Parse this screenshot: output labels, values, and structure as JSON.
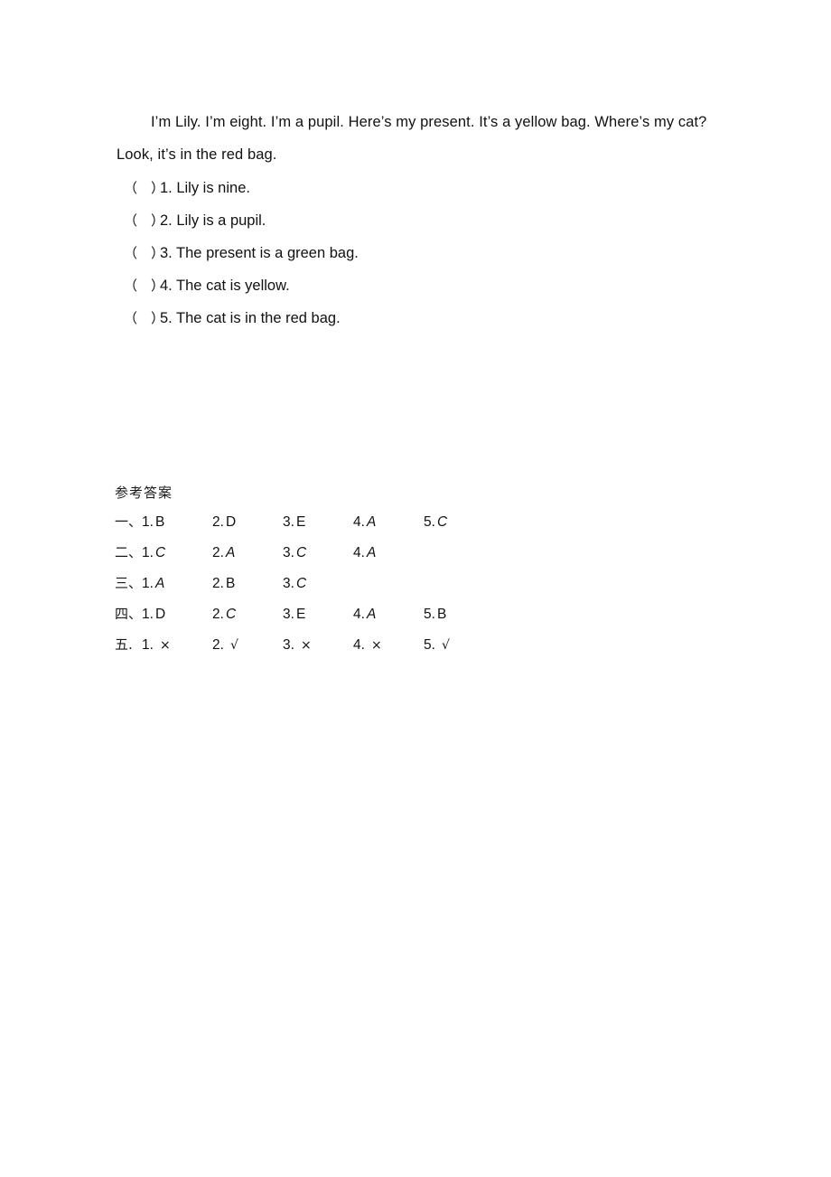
{
  "passage": {
    "line1": "I’m Lily. I’m eight. I’m a pupil. Here’s my present. It’s a yellow bag. Where’s my cat?",
    "line2": "Look, it’s in the red bag."
  },
  "true_false": {
    "bracket": "（　）",
    "items": [
      {
        "bracket": "（　）",
        "text": "1. Lily is nine."
      },
      {
        "bracket": "（　）",
        "text": "2. Lily is a pupil."
      },
      {
        "bracket": "（　）",
        "text": "3. The present is a green bag."
      },
      {
        "bracket": "（　）",
        "text": "4. The cat is yellow."
      },
      {
        "bracket": "（　）",
        "text": "5. The cat is in the red bag."
      }
    ]
  },
  "answer_key": {
    "title": "参考答案",
    "rows": [
      {
        "label": "一、",
        "cells": [
          {
            "num": "1.",
            "val": "B",
            "italic": false
          },
          {
            "num": "2.",
            "val": "D",
            "italic": false
          },
          {
            "num": "3.",
            "val": "E",
            "italic": false
          },
          {
            "num": "4.",
            "val": "A",
            "italic": true
          },
          {
            "num": "5.",
            "val": "C",
            "italic": true
          }
        ]
      },
      {
        "label": "二、",
        "cells": [
          {
            "num": "1.",
            "val": "C",
            "italic": true
          },
          {
            "num": "2.",
            "val": "A",
            "italic": true
          },
          {
            "num": "3.",
            "val": "C",
            "italic": true
          },
          {
            "num": "4.",
            "val": "A",
            "italic": true
          }
        ]
      },
      {
        "label": "三、",
        "cells": [
          {
            "num": "1.",
            "val": "A",
            "italic": true
          },
          {
            "num": "2.",
            "val": "B",
            "italic": false
          },
          {
            "num": "3.",
            "val": "C",
            "italic": true
          }
        ]
      },
      {
        "label": "四、",
        "cells": [
          {
            "num": "1.",
            "val": "D",
            "italic": false
          },
          {
            "num": "2.",
            "val": "C",
            "italic": true
          },
          {
            "num": "3.",
            "val": "E",
            "italic": false
          },
          {
            "num": "4.",
            "val": "A",
            "italic": true
          },
          {
            "num": "5.",
            "val": "B",
            "italic": false
          }
        ]
      },
      {
        "label": "五.",
        "marks": true,
        "cells": [
          {
            "num": "1.",
            "val": "×",
            "italic": false
          },
          {
            "num": "2.",
            "val": "√",
            "italic": false
          },
          {
            "num": "3.",
            "val": "×",
            "italic": false
          },
          {
            "num": "4.",
            "val": "×",
            "italic": false
          },
          {
            "num": "5.",
            "val": "√",
            "italic": false
          }
        ]
      }
    ]
  }
}
